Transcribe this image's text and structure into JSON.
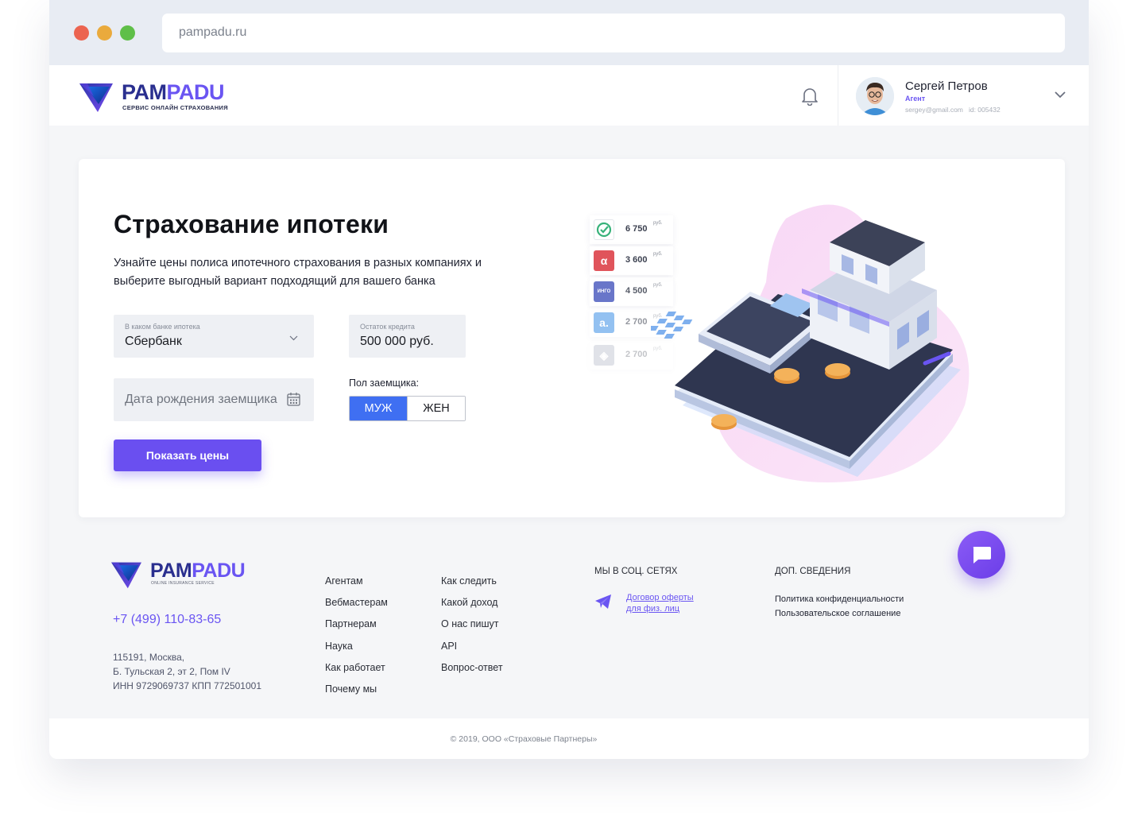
{
  "browser": {
    "url": "pampadu.ru"
  },
  "brand": {
    "name_part1": "PAM",
    "name_part2": "PADU",
    "tagline": "СЕРВИС ОНЛАЙН СТРАХОВАНИЯ",
    "footer_tagline": "ONLINE INSURANCE SERVICE",
    "accent": "#6a55f2",
    "dark": "#2a2f8f"
  },
  "user": {
    "name": "Сергей Петров",
    "role": "Агент",
    "email": "sergey@gmail.com",
    "id": "id: 005432"
  },
  "hero": {
    "title": "Страхование ипотеки",
    "subtitle": "Узнайте цены полиса ипотечного страхования в разных компаниях и выберите выгодный вариант подходящий для вашего банка"
  },
  "form": {
    "bank": {
      "label": "В каком банке ипотека",
      "value": "Сбербанк"
    },
    "credit": {
      "label": "Остаток кредита",
      "value": "500 000 руб."
    },
    "birth": {
      "placeholder": "Дата рождения заемщика"
    },
    "gender": {
      "label": "Пол заемщика:",
      "male": "МУЖ",
      "female": "ЖЕН",
      "selected": "МУЖ"
    },
    "submit": "Показать цены"
  },
  "prices": [
    {
      "value": "6 750",
      "unit": "руб.",
      "icon": "check-icon",
      "color": "#38b27a"
    },
    {
      "value": "3 600",
      "unit": "руб.",
      "icon": "alpha-icon",
      "color": "#e0545b"
    },
    {
      "value": "4 500",
      "unit": "руб.",
      "icon": "ingo-icon",
      "badge": "ИНГО",
      "color": "#4f5fc0"
    },
    {
      "value": "2 700",
      "unit": "руб.",
      "icon": "a-icon",
      "color": "#3c8fe6"
    },
    {
      "value": "2 700",
      "unit": "руб.",
      "icon": "shield-icon",
      "color": "#9aa3b5"
    }
  ],
  "footer": {
    "phone": "+7 (499) 110-83-65",
    "address": [
      "115191, Москва,",
      "Б. Тульская 2, эт 2, Пом IV",
      "ИНН 9729069737 КПП 772501001"
    ],
    "col1": [
      "Агентам",
      "Вебмастерам",
      "Партнерам",
      "Наука",
      "Как работает",
      "Почему мы"
    ],
    "col2": [
      "Как следить",
      "Какой доход",
      "О нас пишут",
      "API",
      "Вопрос-ответ"
    ],
    "social_title": "МЫ В СОЦ. СЕТЯХ",
    "social_link_line1": "Договор оферты",
    "social_link_line2": "для физ. лиц",
    "info_title": "ДОП. СВЕДЕНИЯ",
    "info_links": [
      "Политика конфиденциальности",
      "Пользовательское соглашение"
    ],
    "copyright": "© 2019, ООО «Страховые Партнеры»"
  }
}
